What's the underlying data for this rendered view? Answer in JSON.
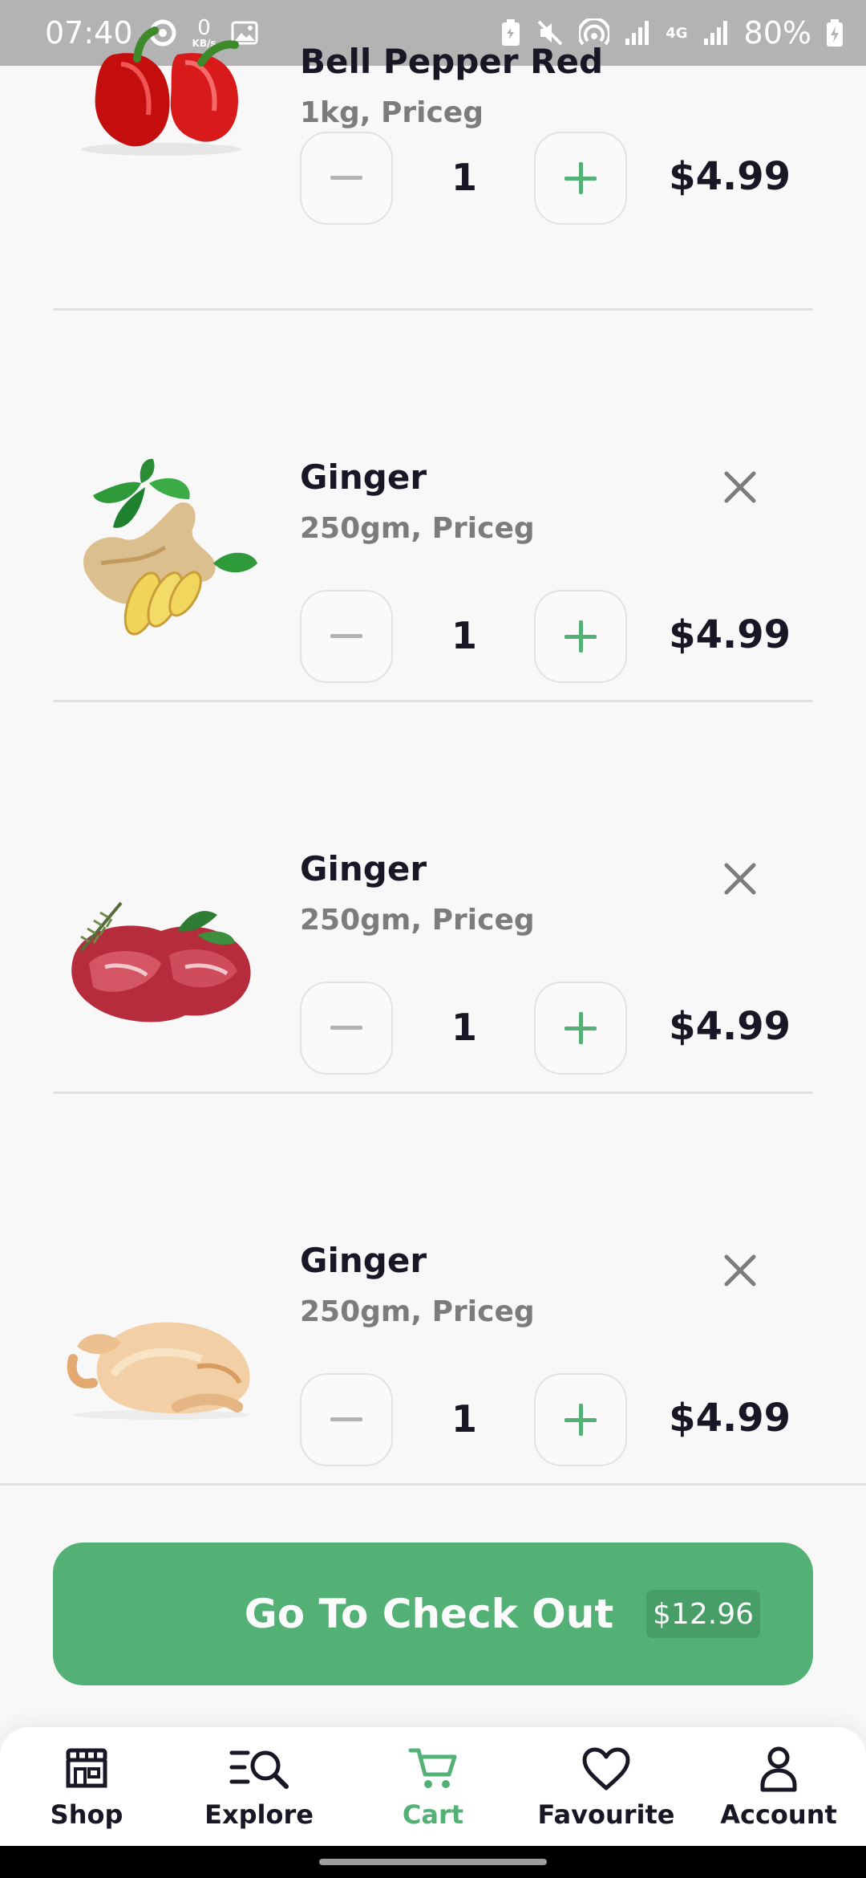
{
  "status_bar": {
    "time": "07:40",
    "net_speed_value": "0",
    "net_speed_unit": "KB/s",
    "network": "4G",
    "battery": "80%"
  },
  "cart": {
    "items": [
      {
        "name": "Bell Pepper Red",
        "desc": "1kg, Priceg",
        "qty": "1",
        "price": "$4.99",
        "image": "red-bell-peppers"
      },
      {
        "name": "Ginger",
        "desc": "250gm, Priceg",
        "qty": "1",
        "price": "$4.99",
        "image": "ginger-root"
      },
      {
        "name": "Ginger",
        "desc": "250gm, Priceg",
        "qty": "1",
        "price": "$4.99",
        "image": "raw-beef-steaks"
      },
      {
        "name": "Ginger",
        "desc": "250gm, Priceg",
        "qty": "1",
        "price": "$4.99",
        "image": "raw-whole-chicken"
      }
    ]
  },
  "checkout": {
    "label": "Go To Check Out",
    "total": "$12.96"
  },
  "nav": {
    "shop": "Shop",
    "explore": "Explore",
    "cart": "Cart",
    "favourite": "Favourite",
    "account": "Account",
    "active": "cart"
  },
  "colors": {
    "accent": "#53b175",
    "text": "#181725",
    "muted": "#7c7c7c",
    "divider": "#e2e2e2"
  }
}
